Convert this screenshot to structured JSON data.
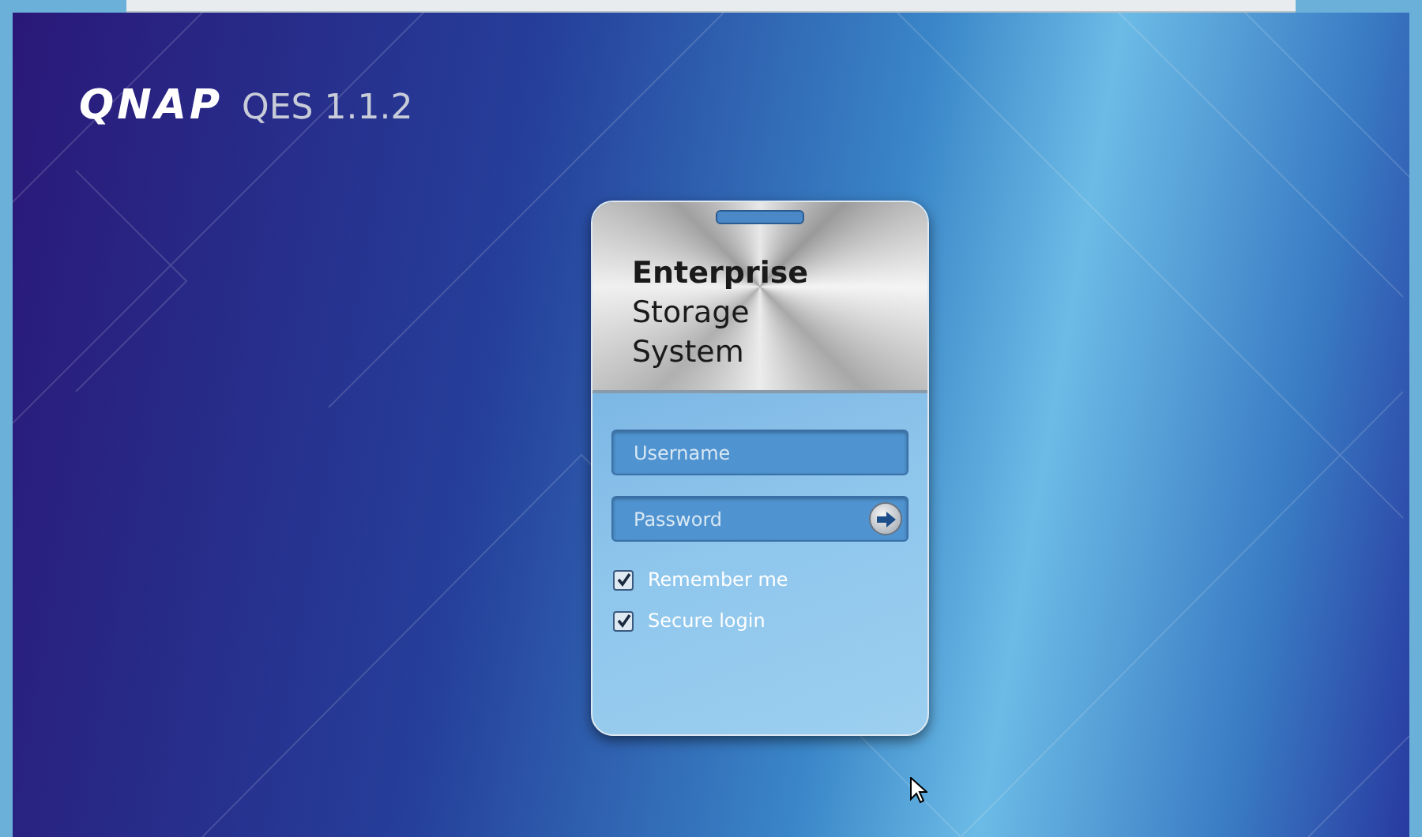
{
  "brand": {
    "logo": "QNAP",
    "product": "QES 1.1.2"
  },
  "card": {
    "title_lines": [
      {
        "text": "Enterprise",
        "bold": true
      },
      {
        "text": "Storage",
        "bold": false
      },
      {
        "text": "System",
        "bold": false
      }
    ],
    "fields": [
      {
        "placeholder": "Username",
        "kind": "text"
      },
      {
        "placeholder": "Password",
        "kind": "password"
      }
    ],
    "checkboxes": [
      {
        "label": "Remember me",
        "checked": true
      },
      {
        "label": "Secure login",
        "checked": true
      }
    ]
  }
}
